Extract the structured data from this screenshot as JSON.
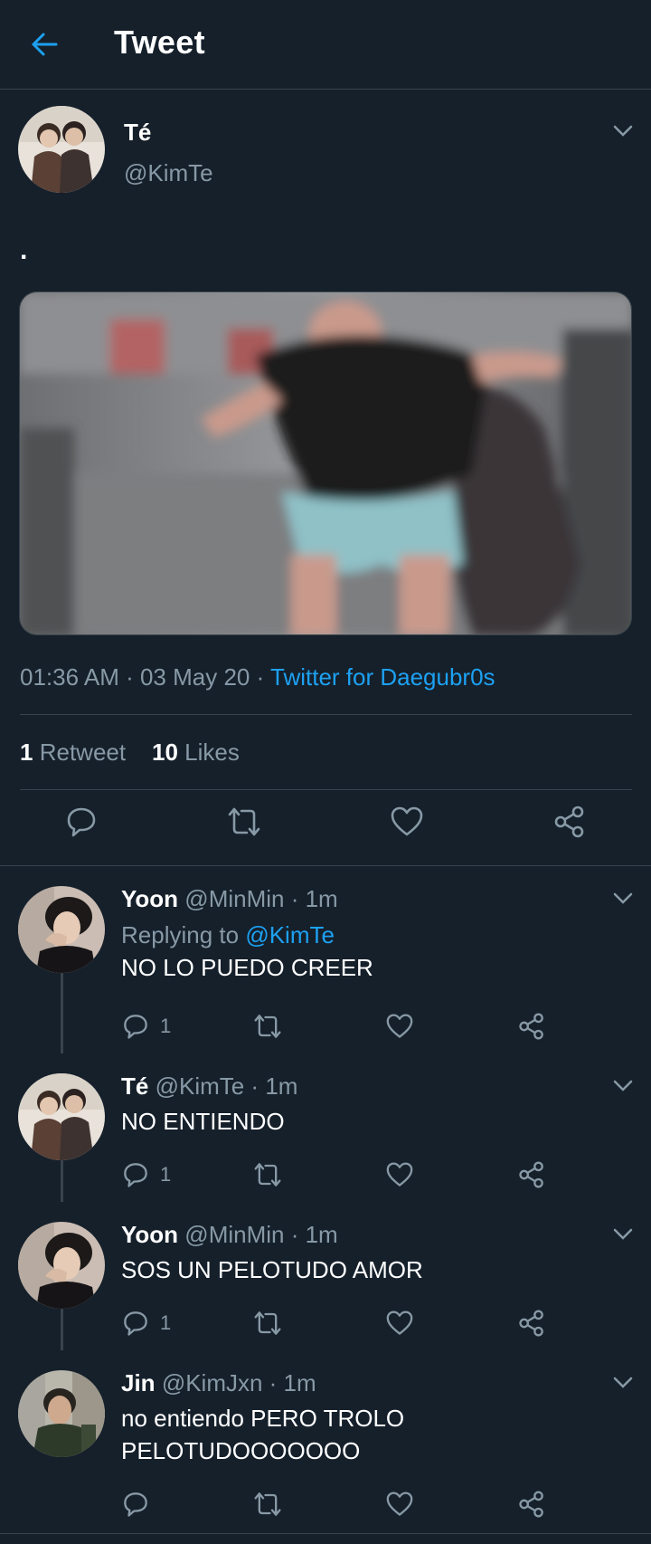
{
  "header": {
    "title": "Tweet"
  },
  "tweet": {
    "name": "Té",
    "handle": "@KimTe",
    "text": ".",
    "time": "01:36 AM · 03 May 20 · ",
    "source": "Twitter for Daegubr0s",
    "retweets": "1",
    "retweets_label": "Retweet",
    "likes": "10",
    "likes_label": "Likes"
  },
  "replies": [
    {
      "name": "Yoon",
      "handle": "@MinMin · 1m",
      "replying_prefix": "Replying to ",
      "replying_to": "@KimTe",
      "text": "NO LO PUEDO CREER",
      "reply_count": "1"
    },
    {
      "name": "Té",
      "handle": "@KimTe · 1m",
      "text": "NO ENTIENDO",
      "reply_count": "1"
    },
    {
      "name": "Yoon",
      "handle": "@MinMin · 1m",
      "text": "SOS UN PELOTUDO AMOR",
      "reply_count": "1"
    },
    {
      "name": "Jin",
      "handle": "@KimJxn · 1m",
      "text": "no entiendo PERO TROLO PELOTUDOOOOOOO",
      "reply_count": ""
    }
  ],
  "colors": {
    "background": "#15202b",
    "divider": "#38444d",
    "accent": "#1da1f2",
    "secondary_text": "#8899a6"
  }
}
